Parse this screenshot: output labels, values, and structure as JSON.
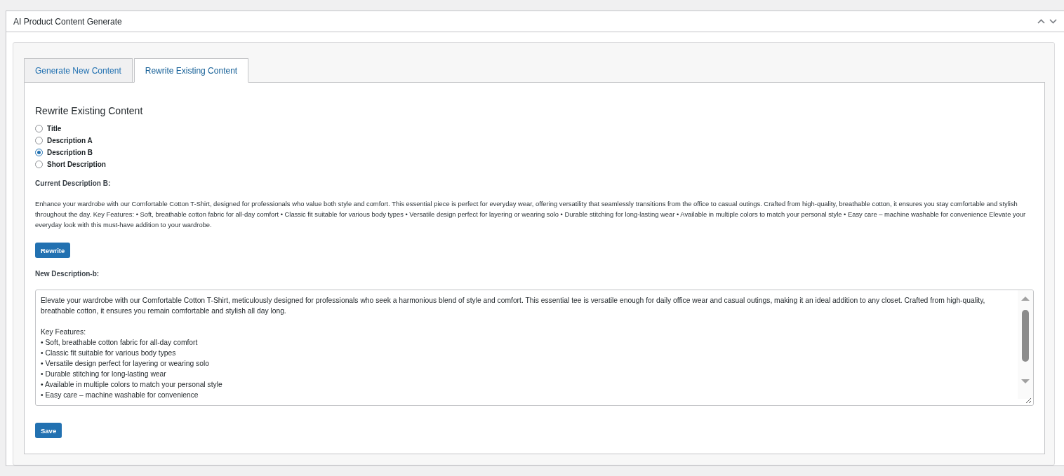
{
  "panel": {
    "title": "AI Product Content Generate"
  },
  "tabs": [
    {
      "label": "Generate New Content",
      "selected": false
    },
    {
      "label": "Rewrite Existing Content",
      "selected": true
    }
  ],
  "section": {
    "heading": "Rewrite Existing Content"
  },
  "options": [
    {
      "label": "Title",
      "selected": false
    },
    {
      "label": "Description A",
      "selected": false
    },
    {
      "label": "Description B",
      "selected": true
    },
    {
      "label": "Short Description",
      "selected": false
    }
  ],
  "current": {
    "label": "Current Description B:",
    "text": "Enhance your wardrobe with our Comfortable Cotton T-Shirt, designed for professionals who value both style and comfort. This essential piece is perfect for everyday wear, offering versatility that seamlessly transitions from the office to casual outings. Crafted from high-quality, breathable cotton, it ensures you stay comfortable and stylish throughout the day. Key Features: • Soft, breathable cotton fabric for all-day comfort • Classic fit suitable for various body types • Versatile design perfect for layering or wearing solo • Durable stitching for long-lasting wear • Available in multiple colors to match your personal style • Easy care – machine washable for convenience Elevate your everyday look with this must-have addition to your wardrobe."
  },
  "rewrite_button": "Rewrite",
  "new": {
    "label": "New Description-b:",
    "value": "Elevate your wardrobe with our Comfortable Cotton T-Shirt, meticulously designed for professionals who seek a harmonious blend of style and comfort. This essential tee is versatile enough for daily office wear and casual outings, making it an ideal addition to any closet. Crafted from high-quality, breathable cotton, it ensures you remain comfortable and stylish all day long.\n\nKey Features:\n• Soft, breathable cotton fabric for all-day comfort\n• Classic fit suitable for various body types\n• Versatile design perfect for layering or wearing solo\n• Durable stitching for long-lasting wear\n• Available in multiple colors to match your personal style\n• Easy care – machine washable for convenience"
  },
  "save_button": "Save"
}
